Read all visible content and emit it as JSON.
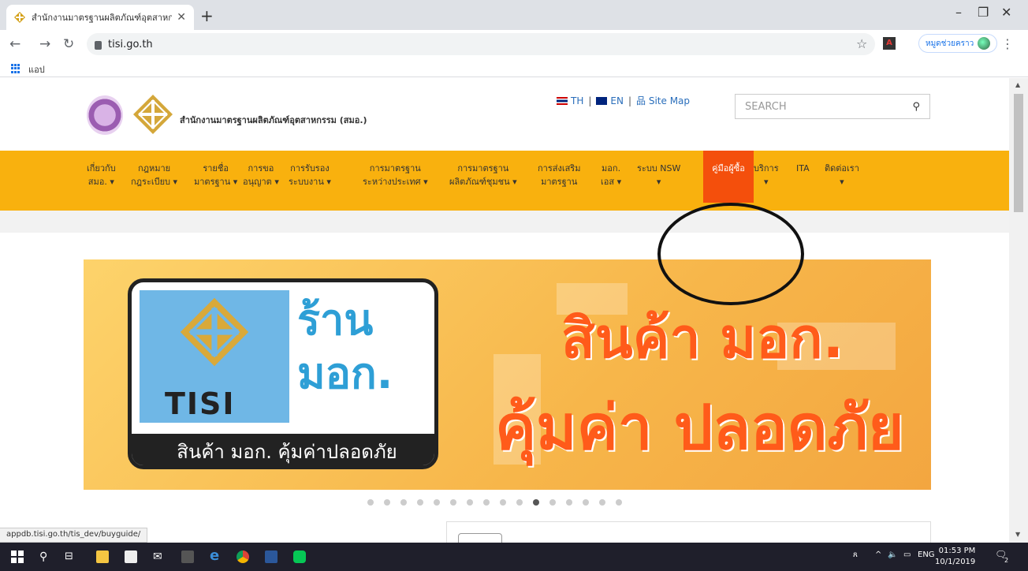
{
  "browser": {
    "tab_title": "สำนักงานมาตรฐานผลิตภัณฑ์อุตสาหกร",
    "url": "tisi.go.th",
    "bookmarks_label": "แอป",
    "profile_name": "หมูดช่วยคราว",
    "status_url": "appdb.tisi.go.th/tis_dev/buyguide/"
  },
  "site": {
    "org_name": "สำนักงานมาตรฐานผลิตภัณฑ์อุตสาหกรรม (สมอ.)",
    "lang_th": "TH",
    "lang_en": "EN",
    "sitemap": "Site Map",
    "search_placeholder": "SEARCH"
  },
  "nav": [
    {
      "l1": "เกี่ยวกับ",
      "l2": "สมอ. ▾"
    },
    {
      "l1": "กฎหมาย",
      "l2": "กฎระเบียบ ▾"
    },
    {
      "l1": "รายชื่อ",
      "l2": "มาตรฐาน ▾"
    },
    {
      "l1": "การขอ",
      "l2": "อนุญาต ▾"
    },
    {
      "l1": "การรับรอง",
      "l2": "ระบบงาน ▾"
    },
    {
      "l1": "การมาตรฐาน",
      "l2": "ระหว่างประเทศ ▾"
    },
    {
      "l1": "การมาตรฐาน",
      "l2": "ผลิตภัณฑ์ชุมชน ▾"
    },
    {
      "l1": "การส่งเสริม",
      "l2": "มาตรฐาน"
    },
    {
      "l1": "มอก.",
      "l2": "เอส ▾"
    },
    {
      "l1": "ระบบ NSW",
      "l2": "▾"
    },
    {
      "l1": "คู่มือผู้ซื้อ",
      "l2": ""
    },
    {
      "l1": "บริการ",
      "l2": "▾"
    },
    {
      "l1": "ITA",
      "l2": ""
    },
    {
      "l1": "ติดต่อเรา",
      "l2": "▾"
    }
  ],
  "banner": {
    "logo_text": "TISI",
    "shop_line1": "ร้าน",
    "shop_line2": "มอก.",
    "tagline": "สินค้า มอก. คุ้มค่าปลอดภัย",
    "headline1": "สินค้า มอก.",
    "headline2": "คุ้มค่า ปลอดภัย",
    "dots_total": 16,
    "active_dot": 10
  },
  "taskbar": {
    "time": "01:53 PM",
    "date": "10/1/2019",
    "lang": "ENG",
    "notif_count": "2"
  },
  "colors": {
    "nav_bg": "#f9b10e",
    "nav_active": "#f44f0c",
    "headline": "#ff5b1a",
    "logo_blue": "#6fb7e6"
  }
}
